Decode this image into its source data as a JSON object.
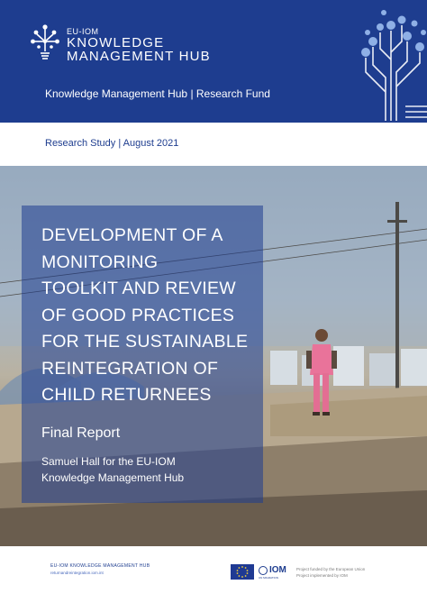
{
  "header": {
    "logo_small": "EU-IOM",
    "logo_line1": "KNOWLEDGE",
    "logo_line2": "MANAGEMENT HUB",
    "subtitle": "Knowledge Management Hub | Research Fund"
  },
  "study_info": "Research Study | August 2021",
  "title_lines": [
    "DEVELOPMENT OF A",
    "MONITORING",
    "TOOLKIT AND REVIEW",
    "OF GOOD PRACTICES",
    "FOR THE SUSTAINABLE",
    "REINTEGRATION OF",
    "CHILD RETURNEES"
  ],
  "report_type": "Final Report",
  "author_line1": "Samuel Hall for the EU-IOM",
  "author_line2": "Knowledge Management Hub",
  "footer": {
    "hub_name": "EU-IOM KNOWLEDGE MANAGEMENT HUB",
    "email": "returnandreintegration.iom.int",
    "iom_label": "IOM",
    "iom_sub": "UN MIGRATION",
    "funded_line1": "Project funded by the European Union",
    "funded_line2": "Project implemented by IOM"
  },
  "colors": {
    "brand_blue": "#1e3d8f",
    "overlay": "rgba(30,61,143,0.55)"
  }
}
